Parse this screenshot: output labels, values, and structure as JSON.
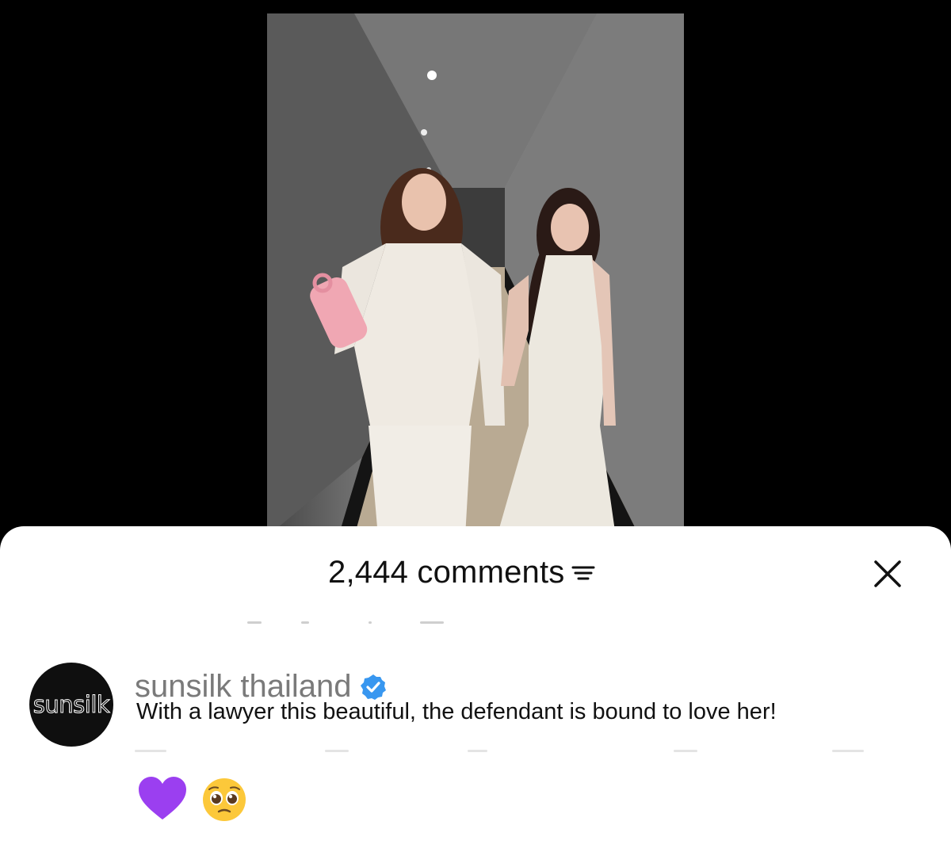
{
  "post": {
    "image_icon": "photo-two-women-hallway"
  },
  "comments_sheet": {
    "count_label": "2,444 comments",
    "sort_icon": "filter-lines-icon",
    "close_icon": "close-icon"
  },
  "comment": {
    "avatar_text": "sunsilk",
    "username": "sunsilk thailand",
    "verified": true,
    "text": "With a lawyer this beautiful, the defendant is bound to love her!",
    "reactions": [
      "purple-heart-emoji",
      "pleading-face-emoji"
    ]
  },
  "colors": {
    "verified_badge": "#3897f0",
    "heart": "#9b3ff0",
    "username": "#7a7a7a"
  }
}
